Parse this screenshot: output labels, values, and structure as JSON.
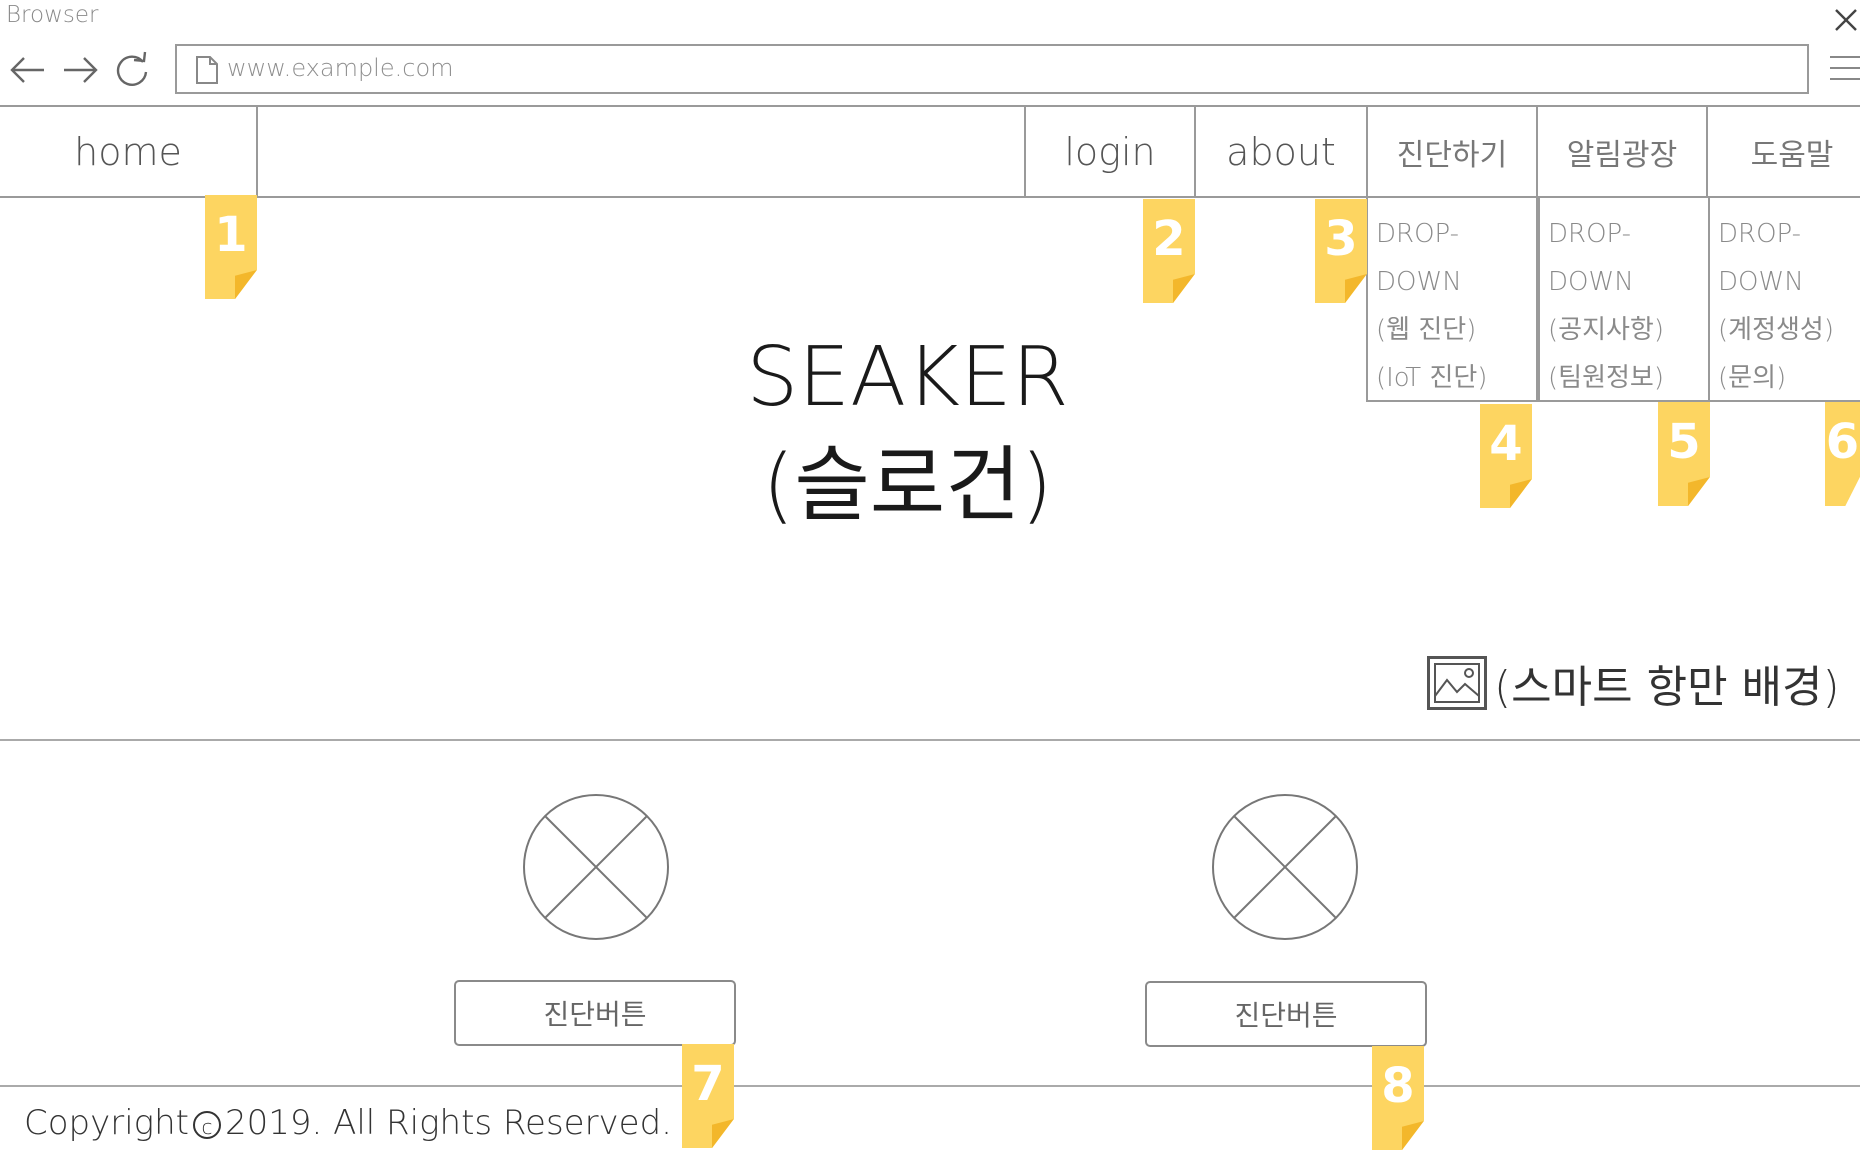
{
  "browser": {
    "title": "Browser",
    "url": "www.example.com"
  },
  "nav": {
    "home": "home",
    "login": "login",
    "about": "about",
    "menus": [
      {
        "label": "진단하기",
        "dropdown": [
          "DROP-",
          "DOWN",
          "(웹 진단)",
          "(IoT 진단)"
        ]
      },
      {
        "label": "알림광장",
        "dropdown": [
          "DROP-",
          "DOWN",
          "(공지사항)",
          "(팀원정보)"
        ]
      },
      {
        "label": "도움말",
        "dropdown": [
          "DROP-",
          "DOWN",
          "(계정생성)",
          "(문의)"
        ]
      }
    ]
  },
  "hero": {
    "title": "SEAKER",
    "slogan": "(슬로건)",
    "background_label": "(스마트 항만 배경)"
  },
  "features": [
    {
      "button": "진단버튼"
    },
    {
      "button": "진단버튼"
    }
  ],
  "footer": {
    "copyright_prefix": "Copyright",
    "copyright_symbol": "c",
    "copyright_suffix": "2019. All Rights Reserved."
  },
  "markers": [
    "1",
    "2",
    "3",
    "4",
    "5",
    "6",
    "7",
    "8"
  ],
  "colors": {
    "marker": "#fdd561",
    "marker_fold": "#f3b72b",
    "line": "#9a9a9a"
  }
}
